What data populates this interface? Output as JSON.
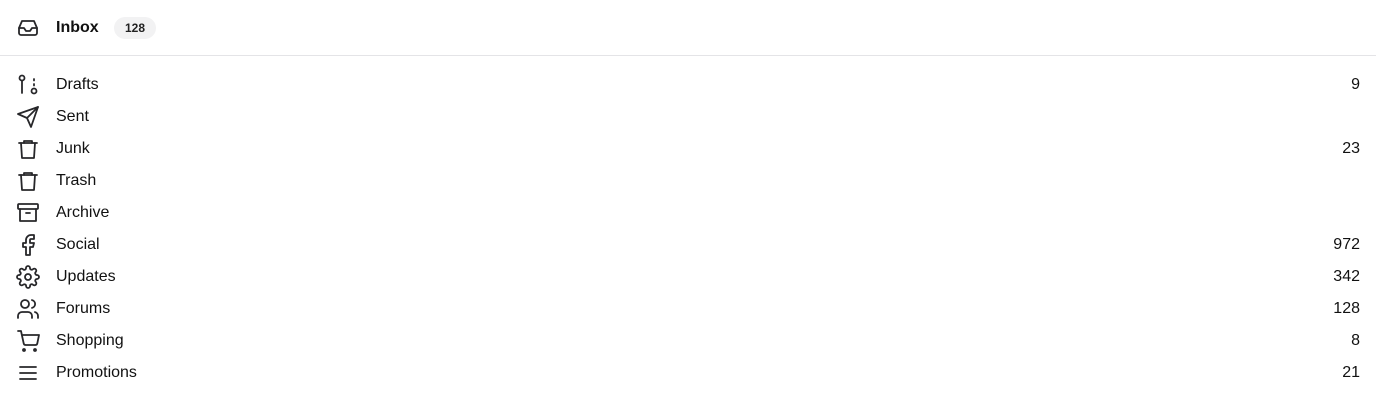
{
  "header": {
    "icon": "inbox-icon",
    "title": "Inbox",
    "badge": "128"
  },
  "folders": [
    {
      "label": "Drafts",
      "count": "9",
      "icon": "git-pull-request-icon"
    },
    {
      "label": "Sent",
      "count": "",
      "icon": "send-icon"
    },
    {
      "label": "Junk",
      "count": "23",
      "icon": "trash-icon"
    },
    {
      "label": "Trash",
      "count": "",
      "icon": "trash-icon"
    },
    {
      "label": "Archive",
      "count": "",
      "icon": "archive-icon"
    },
    {
      "label": "Social",
      "count": "972",
      "icon": "facebook-icon"
    },
    {
      "label": "Updates",
      "count": "342",
      "icon": "gear-icon"
    },
    {
      "label": "Forums",
      "count": "128",
      "icon": "users-icon"
    },
    {
      "label": "Shopping",
      "count": "8",
      "icon": "shopping-cart-icon"
    },
    {
      "label": "Promotions",
      "count": "21",
      "icon": "menu-icon"
    }
  ]
}
